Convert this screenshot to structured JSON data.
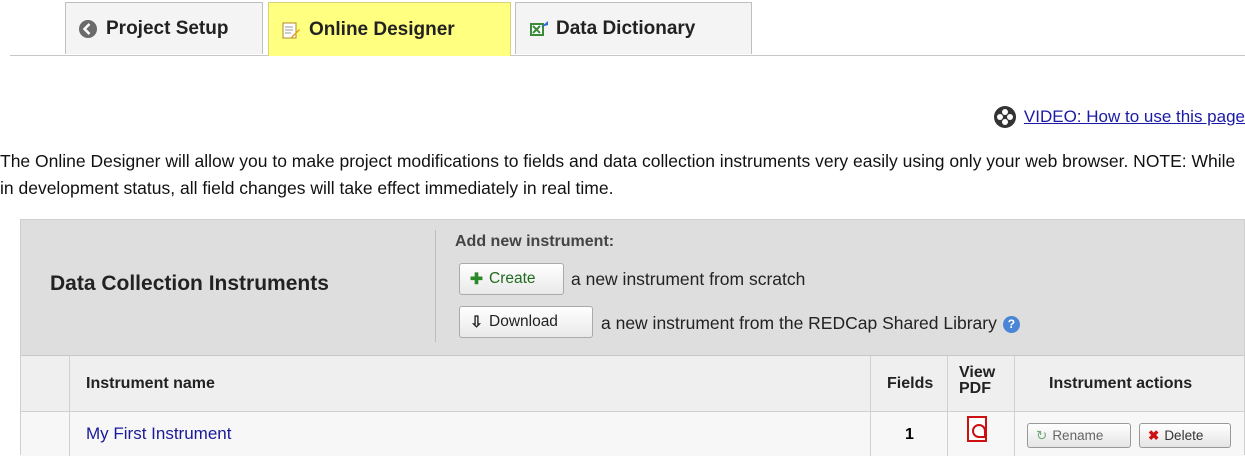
{
  "tabs": [
    {
      "label": "Project Setup",
      "icon": "back-arrow-icon"
    },
    {
      "label": "Online Designer",
      "icon": "edit-form-icon",
      "active": true
    },
    {
      "label": "Data Dictionary",
      "icon": "spreadsheet-icon"
    }
  ],
  "video_link": "VIDEO: How to use this page",
  "intro_text": "The Online Designer will allow you to make project modifications to fields and data collection instruments very easily using only your web browser. NOTE: While in development status, all field changes will take effect immediately in real time.",
  "instruments_panel": {
    "title": "Data Collection Instruments",
    "add_label": "Add new instrument:",
    "create_button": "Create",
    "create_text": "a new instrument from scratch",
    "download_button": "Download",
    "download_text": "a new instrument from the REDCap Shared Library"
  },
  "table": {
    "headers": {
      "name": "Instrument name",
      "fields": "Fields",
      "view_pdf": "View PDF",
      "actions": "Instrument actions"
    },
    "rows": [
      {
        "name": "My First Instrument",
        "fields": "1",
        "rename": "Rename",
        "delete": "Delete"
      }
    ]
  },
  "colors": {
    "active_tab": "#ffff80",
    "link": "#1a1aa6",
    "panel_bg": "#dedede"
  }
}
